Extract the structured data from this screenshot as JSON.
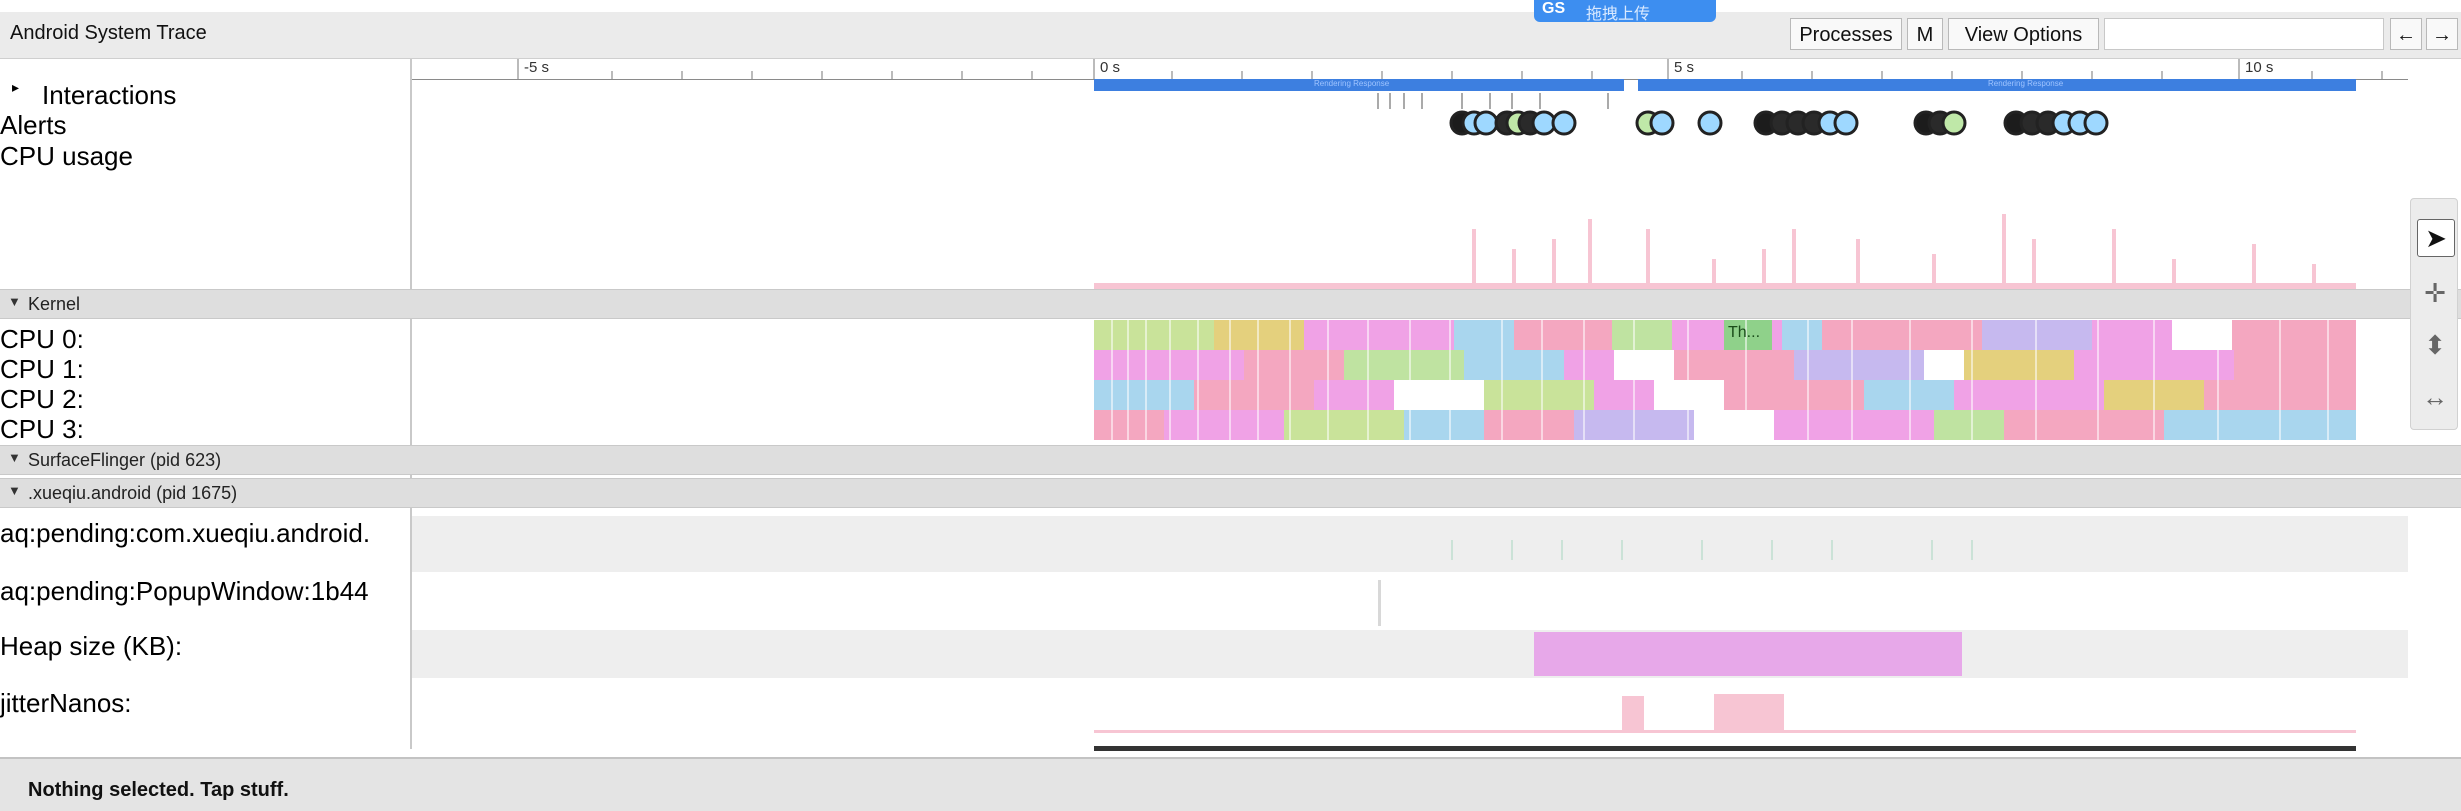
{
  "window": {
    "title": "Android System Trace",
    "buttons": {
      "processes": "Processes",
      "m": "M",
      "view_options": "View Options"
    },
    "search": {
      "value": "",
      "placeholder": ""
    },
    "nav_left": "←",
    "nav_right": "→"
  },
  "upload_overlay": {
    "logo": "GS",
    "label": "拖拽上传"
  },
  "ruler": {
    "ticks": [
      "-5 s",
      "0 s",
      "5 s",
      "10 s"
    ]
  },
  "tracks": {
    "interactions": "Interactions",
    "alerts": "Alerts",
    "cpu_usage": "CPU usage",
    "kernel": "Kernel",
    "cpu0": "CPU 0:",
    "cpu1": "CPU 1:",
    "cpu2": "CPU 2:",
    "cpu3": "CPU 3:",
    "surfaceflinger": "SurfaceFlinger (pid 623)",
    "xueqiu": ".xueqiu.android (pid 1675)",
    "pending1": "aq:pending:com.xueqiu.android.",
    "pending2": "aq:pending:PopupWindow:1b44",
    "heap": "Heap size (KB):",
    "jitter": "jitterNanos:",
    "cpu0_slice": "Th..."
  },
  "interactions": {
    "bar1": "Rendering Response",
    "bar2": "Rendering Response"
  },
  "status": "Nothing selected. Tap stuff.",
  "tools": [
    "pointer-icon",
    "pan-icon",
    "zoom-icon",
    "timing-icon"
  ],
  "colors": {
    "accent": "#3d7fe0",
    "pink": "#f4a7c0",
    "heap": "#e7a8e9"
  }
}
